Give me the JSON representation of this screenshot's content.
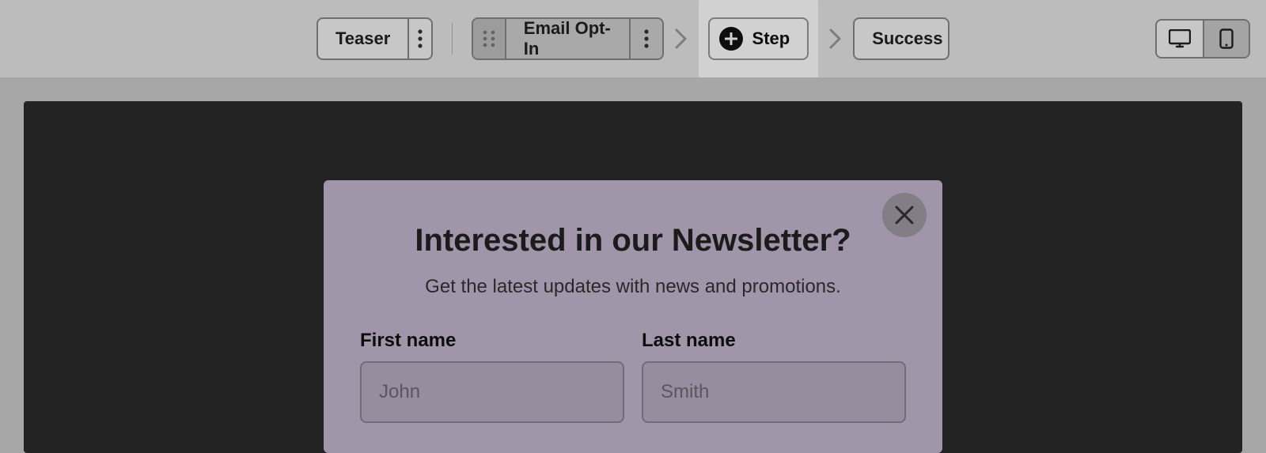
{
  "toolbar": {
    "teaser_label": "Teaser",
    "email_optin_label": "Email Opt-In",
    "step_label": "Step",
    "success_label": "Success"
  },
  "popup": {
    "title": "Interested in our Newsletter?",
    "subtitle": "Get the latest updates with news and promotions.",
    "first_name_label": "First name",
    "first_name_placeholder": "John",
    "last_name_label": "Last name",
    "last_name_placeholder": "Smith"
  }
}
